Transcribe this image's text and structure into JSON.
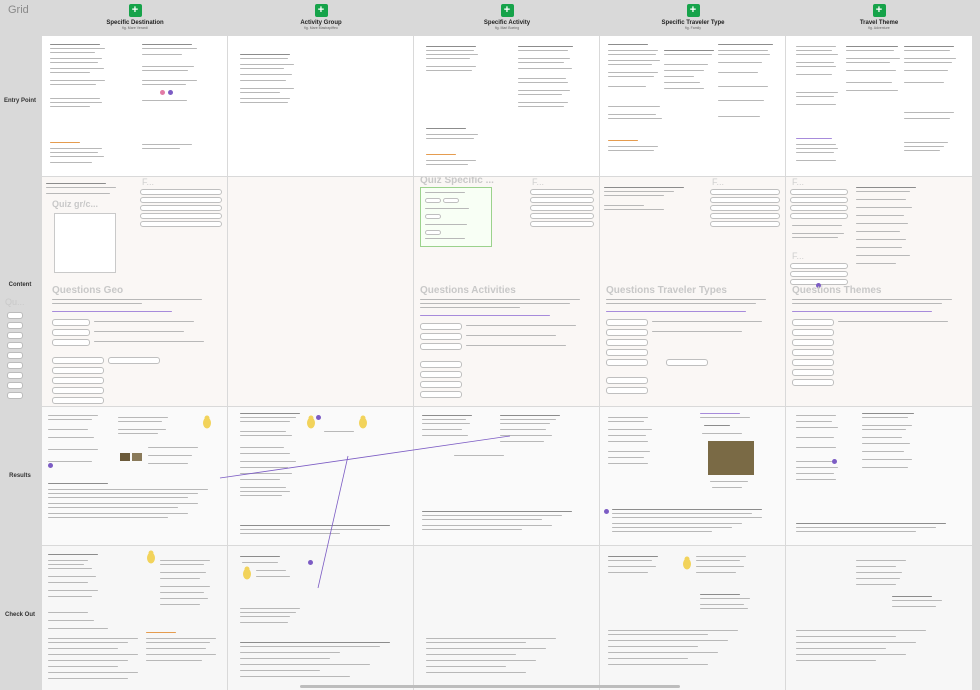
{
  "board": {
    "title": "Grid"
  },
  "columns": [
    {
      "title": "Specific Destination",
      "subtitle": "fig. Mare Verardi"
    },
    {
      "title": "Activity Group",
      "subtitle": "fig. Mare Mastrapiffeo"
    },
    {
      "title": "Specific Activity",
      "subtitle": "fig. Mari Boeing"
    },
    {
      "title": "Specific Traveler Type",
      "subtitle": "fig. Family"
    },
    {
      "title": "Travel Theme",
      "subtitle": "fig. Adventure"
    }
  ],
  "rows": [
    {
      "label": "Entry Point"
    },
    {
      "label": "Content"
    },
    {
      "label": "Results"
    },
    {
      "label": "Check Out"
    }
  ],
  "content_sections": {
    "quiz_specific": "Quiz Specific ...",
    "quiz_gr": "Quiz gr/c...",
    "questions_geo": "Questions Geo",
    "questions_activities": "Questions Activities",
    "questions_traveler_types": "Questions Traveler Types",
    "questions_themes": "Questions Themes",
    "qu": "Qu..."
  },
  "icons": {
    "plus": "+",
    "add_column": "plus-icon"
  },
  "colors": {
    "accent_green": "#16a34a",
    "accent_purple": "#7c5cc4",
    "mascot_yellow": "#f2d35b"
  }
}
